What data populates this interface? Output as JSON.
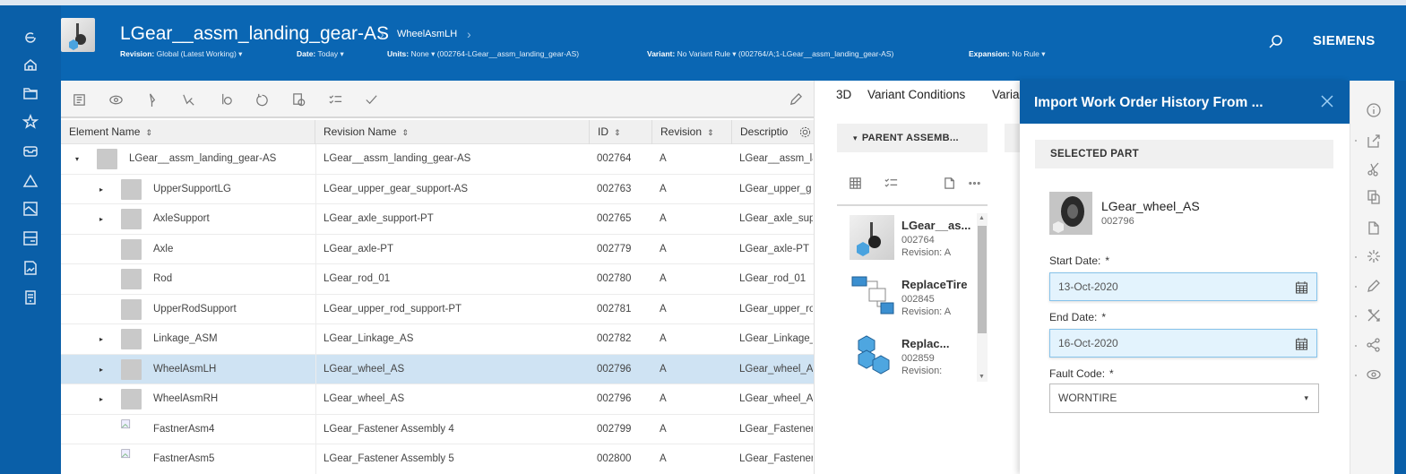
{
  "header": {
    "title": "LGear__assm_landing_gear-AS",
    "breadcrumb": "WheelAsmLH",
    "breadcrumb_separator": "›",
    "revision_label": "Revision:",
    "revision_value": "Global (Latest Working) ▾",
    "date_label": "Date:",
    "date_value": "Today ▾",
    "units_label": "Units:",
    "units_value": "None ▾",
    "units_context": "(002764-LGear__assm_landing_gear-AS)",
    "variant_label": "Variant:",
    "variant_value": "No Variant Rule ▾",
    "variant_context": "(002764/A;1-LGear__assm_landing_gear-AS)",
    "expansion_label": "Expansion:",
    "expansion_value": "No Rule ▾",
    "brand": "SIEMENS"
  },
  "left_nav": {
    "items": [
      "back-icon",
      "home-icon",
      "folder-icon",
      "star-icon",
      "inbox-icon",
      "change-icon",
      "image-icon",
      "archive-icon",
      "report-icon",
      "document-icon"
    ]
  },
  "toolbar": {
    "icons": [
      "structure-icon",
      "visibility-icon",
      "pin-icon",
      "markup-icon",
      "measure-icon",
      "undo-icon",
      "compare-icon",
      "checklist-icon",
      "check-icon"
    ],
    "edit_icon": "pencil-icon"
  },
  "table": {
    "columns": [
      {
        "label": "Element Name",
        "sort": "⇕"
      },
      {
        "label": "Revision Name",
        "sort": "⇕"
      },
      {
        "label": "ID",
        "sort": "⇕"
      },
      {
        "label": "Revision",
        "sort": "⇕"
      },
      {
        "label": "Descriptio",
        "sort": ""
      }
    ],
    "rows": [
      {
        "element": "LGear__assm_landing_gear-AS",
        "revision_name": "LGear__assm_landing_gear-AS",
        "id": "002764",
        "revision": "A",
        "description": "LGear__assm_la",
        "expand": "▾",
        "level": 0,
        "selected": false
      },
      {
        "element": "UpperSupportLG",
        "revision_name": "LGear_upper_gear_support-AS",
        "id": "002763",
        "revision": "A",
        "description": "LGear_upper_g",
        "expand": "▸",
        "level": 1,
        "selected": false
      },
      {
        "element": "AxleSupport",
        "revision_name": "LGear_axle_support-PT",
        "id": "002765",
        "revision": "A",
        "description": "LGear_axle_sup",
        "expand": "▸",
        "level": 1,
        "selected": false
      },
      {
        "element": "Axle",
        "revision_name": "LGear_axle-PT",
        "id": "002779",
        "revision": "A",
        "description": "LGear_axle-PT",
        "expand": "",
        "level": 1,
        "selected": false
      },
      {
        "element": "Rod",
        "revision_name": "LGear_rod_01",
        "id": "002780",
        "revision": "A",
        "description": "LGear_rod_01",
        "expand": "",
        "level": 1,
        "selected": false
      },
      {
        "element": "UpperRodSupport",
        "revision_name": "LGear_upper_rod_support-PT",
        "id": "002781",
        "revision": "A",
        "description": "LGear_upper_ro",
        "expand": "",
        "level": 1,
        "selected": false
      },
      {
        "element": "Linkage_ASM",
        "revision_name": "LGear_Linkage_AS",
        "id": "002782",
        "revision": "A",
        "description": "LGear_Linkage_",
        "expand": "▸",
        "level": 1,
        "selected": false
      },
      {
        "element": "WheelAsmLH",
        "revision_name": "LGear_wheel_AS",
        "id": "002796",
        "revision": "A",
        "description": "LGear_wheel_A",
        "expand": "▸",
        "level": 1,
        "selected": true
      },
      {
        "element": "WheelAsmRH",
        "revision_name": "LGear_wheel_AS",
        "id": "002796",
        "revision": "A",
        "description": "LGear_wheel_A",
        "expand": "▸",
        "level": 1,
        "selected": false
      },
      {
        "element": "FastnerAsm4",
        "revision_name": "LGear_Fastener Assembly 4",
        "id": "002799",
        "revision": "A",
        "description": "LGear_Fastener",
        "expand": "",
        "level": 1,
        "selected": false,
        "broken_image": true
      },
      {
        "element": "FastnerAsm5",
        "revision_name": "LGear_Fastener Assembly 5",
        "id": "002800",
        "revision": "A",
        "description": "LGear_Fastener",
        "expand": "",
        "level": 1,
        "selected": false,
        "broken_image": true
      }
    ]
  },
  "mid_panel": {
    "tabs": [
      "3D",
      "Variant Conditions",
      "Varia"
    ],
    "section_title": "PARENT ASSEMB...",
    "section_caret": "▾",
    "list": [
      {
        "title": "LGear__as...",
        "id": "002764",
        "revision": "Revision:  A",
        "thumb": "assembly-thumbnail"
      },
      {
        "title": "ReplaceTire",
        "id": "002845",
        "revision": "Revision:  A",
        "thumb": "process-icon"
      },
      {
        "title": "Replac...",
        "id": "002859",
        "revision": "Revision:",
        "thumb": "blocks-icon"
      }
    ]
  },
  "dialog": {
    "title": "Import Work Order History From ...",
    "section": "SELECTED PART",
    "part_name": "LGear_wheel_AS",
    "part_id": "002796",
    "start_label": "Start Date:",
    "start_value": "13-Oct-2020",
    "end_label": "End Date:",
    "end_value": "16-Oct-2020",
    "fault_label": "Fault Code:",
    "fault_value": "WORNTIRE",
    "required_mark": "*",
    "select_caret": "▾"
  },
  "right_bar": {
    "icons": [
      "info-icon",
      "open-in-icon",
      "cut-icon",
      "copy-icon",
      "paste-icon",
      "explode-icon",
      "edit-icon",
      "tools-icon",
      "share-icon",
      "view-icon"
    ]
  },
  "colors": {
    "primary": "#0a5fa8",
    "header": "#0a66b3",
    "selected_row": "#cfe3f3",
    "date_field": "#e3f3fd"
  }
}
